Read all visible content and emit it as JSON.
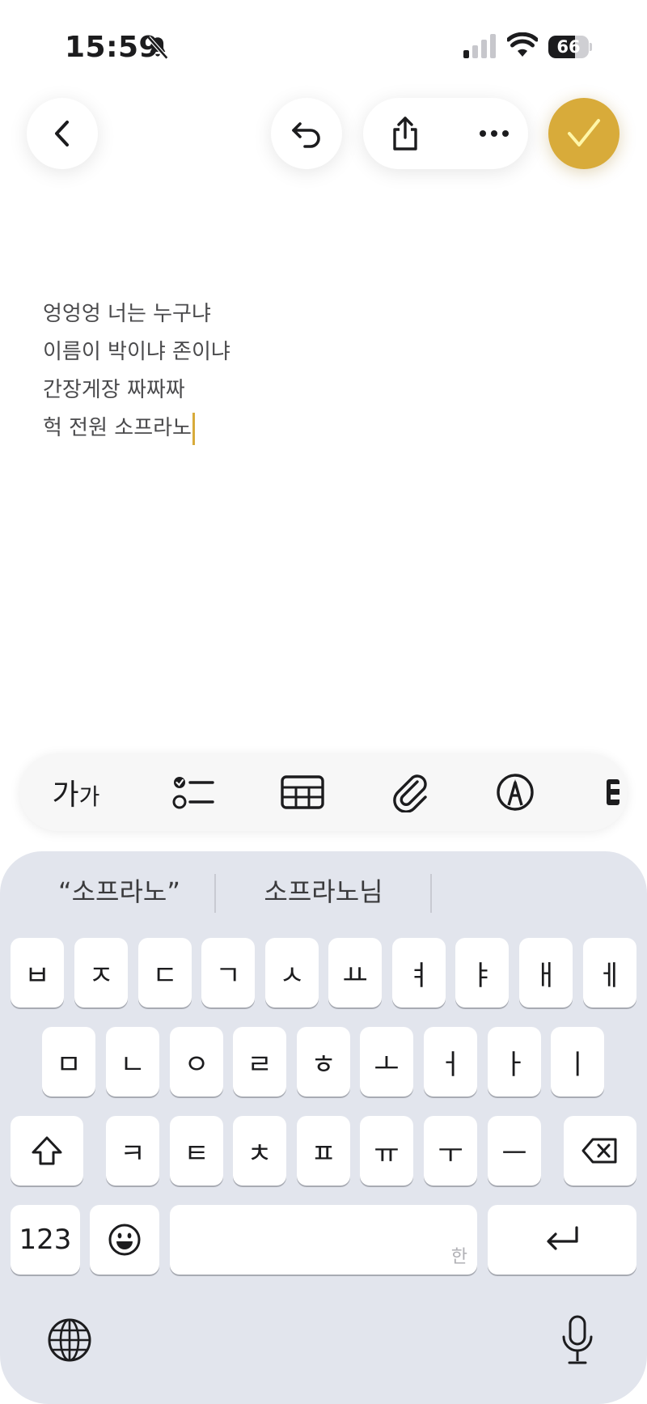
{
  "status_bar": {
    "time": "15:59",
    "battery": "66",
    "battery_level": 0.66,
    "icons": [
      "bell-slash-icon",
      "cellular-signal-icon",
      "wifi-icon",
      "battery-icon"
    ]
  },
  "toolbar": {
    "icons": [
      "chevron-left-icon",
      "undo-icon",
      "share-icon",
      "more-icon",
      "checkmark-icon"
    ],
    "accent_color": "#d8ab3a"
  },
  "note": {
    "lines": [
      "엉엉엉 너는 누구냐",
      "이름이 박이냐 존이냐",
      "간장게장 짜짜짜",
      "헉 전원 소프라노"
    ]
  },
  "format_bar": {
    "text_style_label_a": "가",
    "text_style_label_b": "가",
    "icons": [
      "text-format-icon",
      "checklist-icon",
      "table-icon",
      "attachment-icon",
      "markup-pen-icon",
      "partial-icon"
    ]
  },
  "keyboard": {
    "suggestions": [
      "“소프라노”",
      "소프라노님"
    ],
    "row1": [
      "ㅂ",
      "ㅈ",
      "ㄷ",
      "ㄱ",
      "ㅅ",
      "ㅛ",
      "ㅕ",
      "ㅑ",
      "ㅐ",
      "ㅔ"
    ],
    "row2": [
      "ㅁ",
      "ㄴ",
      "ㅇ",
      "ㄹ",
      "ㅎ",
      "ㅗ",
      "ㅓ",
      "ㅏ",
      "ㅣ"
    ],
    "row3": [
      "ㅋ",
      "ㅌ",
      "ㅊ",
      "ㅍ",
      "ㅠ",
      "ㅜ",
      "ㅡ"
    ],
    "numbers_label": "123",
    "space_hint": "한",
    "icons": [
      "shift-icon",
      "delete-icon",
      "emoji-icon",
      "return-icon",
      "globe-icon",
      "microphone-icon"
    ]
  }
}
